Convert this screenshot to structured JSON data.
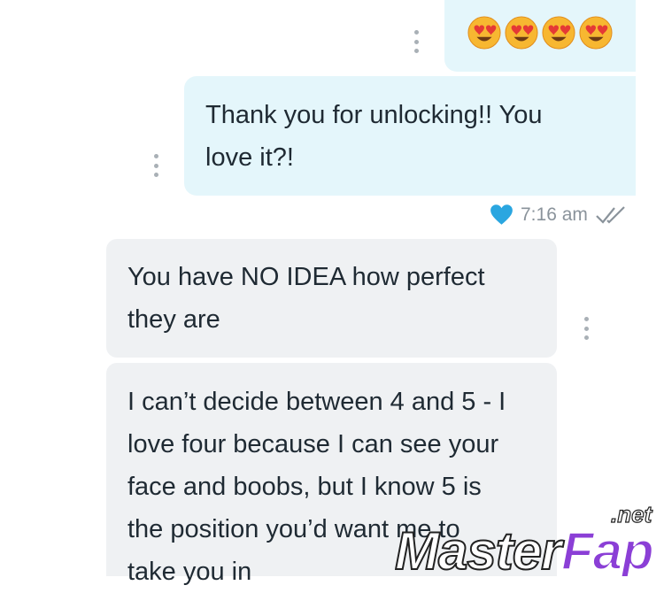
{
  "messages": [
    {
      "sender": "me",
      "type": "emoji",
      "emoji_count": 4,
      "emoji_name": "heart-eyes-emoji"
    },
    {
      "sender": "me",
      "type": "text",
      "lines": [
        "Thank you for unlocking!! You",
        "love it?!"
      ]
    },
    {
      "sender": "them",
      "type": "text",
      "lines": [
        "You have NO IDEA how perfect",
        "they are"
      ]
    },
    {
      "sender": "them",
      "type": "text",
      "lines": [
        "I can’t decide between 4 and 5 - I",
        "love four because I can see your",
        "face and boobs, but I know 5 is",
        "the position you’d want me to",
        "take you in"
      ]
    }
  ],
  "status": {
    "time": "7:16 am",
    "liked": true,
    "read": true
  },
  "colors": {
    "accent_heart": "#2aa6e0",
    "outgoing_bubble": "#e4f6fb",
    "incoming_bubble": "#eff1f3"
  },
  "watermark": {
    "text": "MasterFap",
    "suffix": ".net",
    "master_part": "Master",
    "fap_part": "Fap"
  }
}
